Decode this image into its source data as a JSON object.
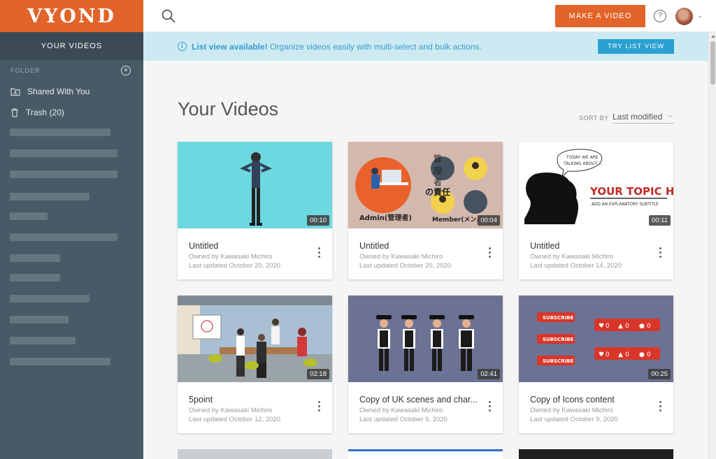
{
  "brand": {
    "logo": "VYOND",
    "accent": "#e2642a"
  },
  "sidebar": {
    "tab": "YOUR VIDEOS",
    "folder_label": "FOLDER",
    "add_icon": "plus-circle-icon",
    "items": [
      {
        "label": "Shared With You",
        "icon": "shared-folder-icon"
      },
      {
        "label": "Trash (20)",
        "icon": "trash-icon"
      }
    ]
  },
  "topbar": {
    "make_video": "MAKE A VIDEO",
    "help": "?",
    "avatar_chevron": "v"
  },
  "banner": {
    "info": "i",
    "bold": "List view available!",
    "text": " Organize videos easily with multi-select and bulk actions.",
    "button": "TRY LIST VIEW"
  },
  "main": {
    "title": "Your Videos",
    "sort_label": "SORT BY",
    "sort_value": "Last modified"
  },
  "videos": [
    {
      "title": "Untitled",
      "owner": "Owned by Kawasaki Michiro",
      "updated": "Last updated October 20, 2020",
      "duration": "00:10"
    },
    {
      "title": "Untitled",
      "owner": "Owned by Kawasaki Michiro",
      "updated": "Last updated October 20, 2020",
      "duration": "00:04",
      "thumb_text": [
        "管",
        "理",
        "者",
        "の責任",
        "Admin(管理者)",
        "Member(メンバ"
      ]
    },
    {
      "title": "Untitled",
      "owner": "Owned by Kawasaki Michiro",
      "updated": "Last updated October 14, 2020",
      "duration": "00:11",
      "thumb_text": [
        "TODAY WE ARE",
        "TALKING ABOUT ...",
        "YOUR TOPIC HERE",
        "ADD AN EXPLANATORY SUBTITLE"
      ]
    },
    {
      "title": "5point",
      "owner": "Owned by Kawasaki Michiro",
      "updated": "Last updated October 12, 2020",
      "duration": "02:18"
    },
    {
      "title": "Copy of UK scenes and char...",
      "owner": "Owned by Kawasaki Michiro",
      "updated": "Last updated October 9, 2020",
      "duration": "02:41"
    },
    {
      "title": "Copy of Icons content",
      "owner": "Owned by Kawasaki Michiro",
      "updated": "Last updated October 9, 2020",
      "duration": "00:25",
      "thumb_text": [
        "SUBSCRIBE",
        "SUBSCRIBE",
        "SUBSCRIBE",
        "0",
        "0",
        "0",
        "0",
        "0",
        "0"
      ]
    }
  ]
}
